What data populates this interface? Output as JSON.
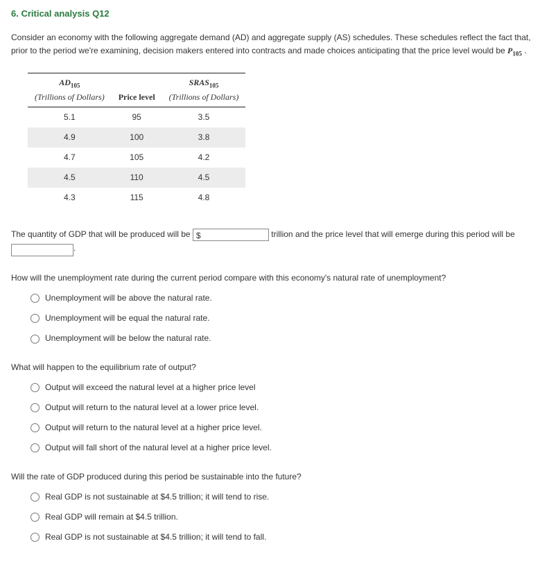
{
  "heading": "6. Critical analysis Q12",
  "intro_part1": "Consider an economy with the following aggregate demand (AD) and aggregate supply (AS) schedules. These schedules reflect the fact that, prior to the period we're examining, decision makers entered into contracts and made choices anticipating that the price level would be ",
  "intro_price_sym": "P",
  "intro_price_sub": "105",
  "intro_part2": " .",
  "table": {
    "head_ad_sym": "AD",
    "head_ad_sub": "105",
    "head_ad_unit": "(Trillions of Dollars)",
    "head_price": "Price level",
    "head_sras_sym": "SRAS",
    "head_sras_sub": "105",
    "head_sras_unit": "(Trillions of Dollars)",
    "rows": [
      {
        "ad": "5.1",
        "price": "95",
        "sras": "3.5"
      },
      {
        "ad": "4.9",
        "price": "100",
        "sras": "3.8"
      },
      {
        "ad": "4.7",
        "price": "105",
        "sras": "4.2"
      },
      {
        "ad": "4.5",
        "price": "110",
        "sras": "4.5"
      },
      {
        "ad": "4.3",
        "price": "115",
        "sras": "4.8"
      }
    ]
  },
  "fill": {
    "lead": "The quantity of GDP that will be produced will be ",
    "prefix": "$",
    "mid": " trillion and the price level that will emerge during this period will be ",
    "tail": "."
  },
  "q_unemp": {
    "prompt": "How will the unemployment rate during the current period compare with this economy's natural rate of unemployment?",
    "opts": [
      "Unemployment will be above the natural rate.",
      "Unemployment will be equal the natural rate.",
      "Unemployment will be below the natural rate."
    ]
  },
  "q_output": {
    "prompt": "What will happen to the equilibrium rate of output?",
    "opts": [
      "Output will exceed the natural level at a higher price level",
      "Output will return to the natural level at a lower price level.",
      "Output will return to the natural level at a higher price level.",
      "Output will fall short of the natural level at a higher price level."
    ]
  },
  "q_sustain": {
    "prompt": "Will the rate of GDP produced during this period be sustainable into the future?",
    "opts": [
      "Real GDP is not sustainable at $4.5 trillion; it will tend to rise.",
      "Real GDP will remain at $4.5 trillion.",
      "Real GDP is not sustainable at $4.5 trillion; it will tend to fall."
    ]
  }
}
